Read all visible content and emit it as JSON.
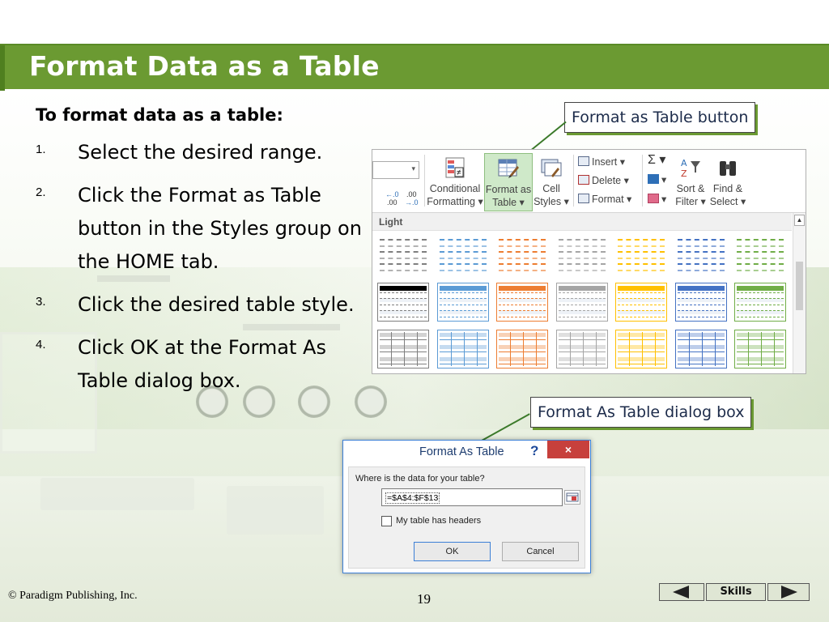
{
  "slide": {
    "title": "Format Data as a Table",
    "heading": "To format data as a table:",
    "steps": [
      {
        "num": "1.",
        "text": "Select the desired range."
      },
      {
        "num": "2.",
        "text": "Click the Format as Table button in the Styles group on the HOME tab."
      },
      {
        "num": "3.",
        "text": "Click the desired table style."
      },
      {
        "num": "4.",
        "text": "Click OK at the Format As Table dialog box."
      }
    ],
    "callouts": {
      "format_as_table_button": "Format as Table button",
      "format_as_table_dialog": "Format As Table dialog box"
    },
    "colors": {
      "title_bar": "#6b9a32",
      "callout_shadow": "#6b9a32",
      "callout_text": "#1c2b4a"
    }
  },
  "ribbon": {
    "number_format_buttons": [
      ".00→.0 increase",
      ".00→.0 decrease"
    ],
    "increase_decimal": "←.0\n.00",
    "decrease_decimal": ".00\n→.0",
    "conditional_formatting": {
      "line1": "Conditional",
      "line2": "Formatting ▾"
    },
    "format_as_table": {
      "line1": "Format as",
      "line2": "Table ▾"
    },
    "cell_styles": {
      "line1": "Cell",
      "line2": "Styles ▾"
    },
    "insert": "Insert ▾",
    "delete": "Delete ▾",
    "format": "Format ▾",
    "sort_filter": {
      "line1": "Sort &",
      "line2": "Filter ▾"
    },
    "find_select": {
      "line1": "Find &",
      "line2": "Select ▾"
    },
    "autosum_icon": "Σ ▾",
    "gallery_label": "Light",
    "style_colors": [
      "#7f7f7f",
      "#5b9bd5",
      "#ed7d31",
      "#a5a5a5",
      "#ffc000",
      "#4472c4",
      "#70ad47"
    ]
  },
  "dialog": {
    "title": "Format As Table",
    "help": "?",
    "close": "×",
    "question": "Where is the data for your table?",
    "range_value": "=$A$4:$F$13",
    "checkbox_label": "My table has headers",
    "ok": "OK",
    "cancel": "Cancel"
  },
  "footer": {
    "copyright": "© Paradigm Publishing, Inc.",
    "page_number": "19",
    "skills": "Skills"
  }
}
